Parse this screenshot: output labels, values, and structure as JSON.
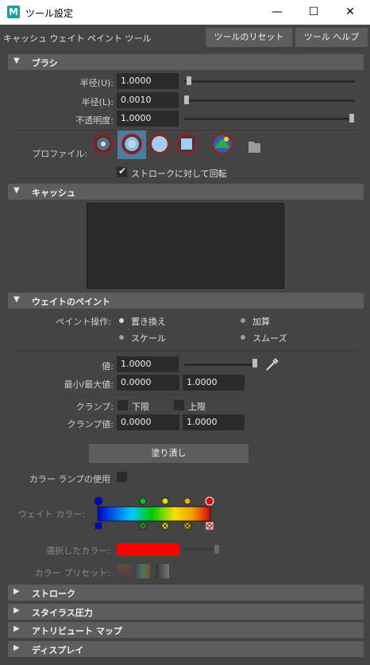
{
  "window": {
    "title": "ツール設定",
    "logo": "M",
    "minimize": "—",
    "maximize": "☐",
    "close": "✕"
  },
  "header": {
    "tool_name": "キャッシュ ウェイト ペイント ツール",
    "reset_label": "ツールのリセット",
    "help_label": "ツール ヘルプ"
  },
  "brush": {
    "section_label": "ブラシ",
    "radius_u_label": "半径(U):",
    "radius_u_value": "1.0000",
    "radius_l_label": "半径(L):",
    "radius_l_value": "0.0010",
    "opacity_label": "不透明度:",
    "opacity_value": "1.0000",
    "profile_label": "プロファイル:",
    "rotate_to_stroke_label": "ストロークに対して回転",
    "rotate_to_stroke_checked": true
  },
  "cache": {
    "section_label": "キャッシュ"
  },
  "paint_weights": {
    "section_label": "ウェイトのペイント",
    "paint_op_label": "ペイント操作:",
    "ops": [
      "置き換え",
      "加算",
      "スケール",
      "スムーズ"
    ],
    "selected_op": "置き換え",
    "value_label": "値:",
    "value_value": "1.0000",
    "minmax_label": "最小/最大値:",
    "min_value": "0.0000",
    "max_value": "1.0000",
    "clamp_label": "クランプ:",
    "clamp_lower": "下限",
    "clamp_upper": "上限",
    "clamp_values_label": "クランプ値:",
    "clamp_min": "0.0000",
    "clamp_max": "1.0000",
    "flood_label": "塗り潰し",
    "use_color_ramp_label": "カラー ランプの使用",
    "weight_color_label": "ウェイト カラー:",
    "selected_color_label": "選択したカラー:",
    "selected_color": "#ff0000",
    "color_presets_label": "カラー プリセット:"
  },
  "collapsed_sections": [
    "ストローク",
    "スタイラス圧力",
    "アトリビュート マップ",
    "ディスプレイ"
  ],
  "colors": {
    "accent": "#4e7c9f",
    "panel": "#444444",
    "field": "#2b2b2b"
  }
}
